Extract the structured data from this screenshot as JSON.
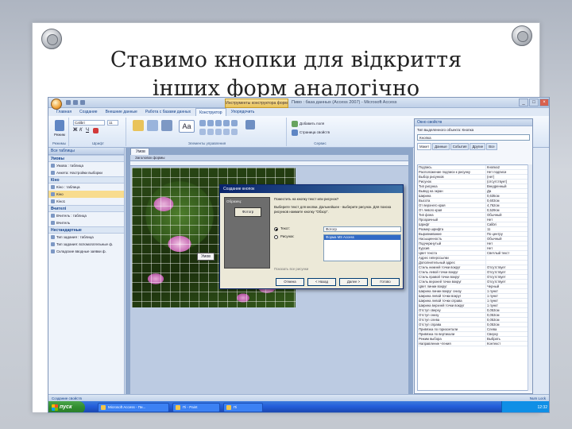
{
  "slide": {
    "title_line1": "Ставимо кнопки для відкриття",
    "title_line2": "інших форм аналогічно"
  },
  "app": {
    "context_tab": "Инструменты конструктора форм",
    "title": "Пиво : база данных (Access 2007) - Microsoft Access",
    "tabs": [
      "Главная",
      "Создание",
      "Внешние данные",
      "Работа с базами данных",
      "Конструктор",
      "Упорядочить"
    ],
    "active_tab_index": 4
  },
  "ribbon": {
    "groups": [
      {
        "label": "Режимы",
        "items": [
          "Режим"
        ]
      },
      {
        "label": "Шрифт",
        "items": [
          "Calibri",
          "11"
        ]
      },
      {
        "label": "Элементы управления",
        "items": []
      },
      {
        "label": "Сервис",
        "items": [
          "Добавить поля",
          "Страница свойств"
        ]
      }
    ]
  },
  "nav": {
    "header": "Все таблицы",
    "groups": [
      {
        "name": "Умовы",
        "items": [
          "Умова : таблица",
          "Анкета: Настройки выборки"
        ]
      },
      {
        "name": "Кіно",
        "items": [
          "Кіно : таблица",
          "Кіно",
          "Кіно1"
        ]
      },
      {
        "name": "Вчителі",
        "items": [
          "Вчитель : таблица",
          "Вчитель"
        ]
      },
      {
        "name": "Нестандартные",
        "items": [
          "Тип задания : таблица",
          "Тип задания: вспомогательные ф.",
          "Складские вводные заявки ф."
        ]
      }
    ]
  },
  "document": {
    "tab": "Умов",
    "header": "Заголовок формы",
    "unit_label": "Умов"
  },
  "wizard": {
    "title": "Создание кнопок",
    "preview_label": "Образец:",
    "preview_button": "Фотогр",
    "question": "Поместить на кнопку текст или рисунок?",
    "instruction": "Выберите текст для кнопки. Дальнейшее - выберите рисунок. Для поиска рисунков нажмите кнопку \"Обзор\".",
    "option_text": "Текст:",
    "option_text_value": "Фотогр",
    "option_picture": "Рисунок:",
    "picture_selected": "Форма MS Access",
    "show_all": "Показать все рисунки",
    "buttons": [
      "Отмена",
      "< Назад",
      "Далее >",
      "Готово"
    ]
  },
  "props": {
    "title": "Окно свойств",
    "subtitle": "Тип выделенного объекта: Кнопка",
    "selected_object": "Кнопка",
    "tabs": [
      "Макет",
      "Данные",
      "События",
      "Другие",
      "Все"
    ],
    "active_tab_index": 0,
    "rows": [
      [
        "Подпись",
        "Кнопка2"
      ],
      [
        "Расположение подписи к рисунку",
        "Нет подписи"
      ],
      [
        "Выбор рисунков",
        "(нет)"
      ],
      [
        "Рисунок",
        "(отсутствует)"
      ],
      [
        "Тип рисунка",
        "Внедренный"
      ],
      [
        "Вывод на экран",
        "Да"
      ],
      [
        "Ширина",
        "0,635см"
      ],
      [
        "Высота",
        "0,603см"
      ],
      [
        "От верхнего края",
        "4,762см"
      ],
      [
        "От левого края",
        "0,529см"
      ],
      [
        "Тип фона",
        "Обычный"
      ],
      [
        "Прозрачный",
        "Нет"
      ],
      [
        "Шрифт",
        "Calibri"
      ],
      [
        "Размер шрифта",
        "11"
      ],
      [
        "Выравнивание",
        "По центру"
      ],
      [
        "Насыщенность",
        "Обычный"
      ],
      [
        "Подчеркнутый",
        "Нет"
      ],
      [
        "Курсив",
        "Нет"
      ],
      [
        "Цвет текста",
        "Светлый текст"
      ],
      [
        "Адрес гиперссылки",
        ""
      ],
      [
        "Дополнительный адрес",
        ""
      ],
      [
        "Стиль нижней точки вокруг",
        "Отсутствует"
      ],
      [
        "Стиль левой точки вокруг",
        "Отсутствует"
      ],
      [
        "Стиль правой точки вокруг",
        "Отсутствует"
      ],
      [
        "Стиль верхней точки вокруг",
        "Отсутствует"
      ],
      [
        "Цвет линии вокруг",
        "Черный"
      ],
      [
        "Ширина линии вокруг снизу",
        "1 пункт"
      ],
      [
        "Ширина левой точки вокруг",
        "1 пункт"
      ],
      [
        "Ширина левой точки справа",
        "1 пункт"
      ],
      [
        "Ширина верхней точки вокруг",
        "1 пункт"
      ],
      [
        "Отступ сверху",
        "0,053см"
      ],
      [
        "Отступ снизу",
        "0,053см"
      ],
      [
        "Отступ слева",
        "0,053см"
      ],
      [
        "Отступ справа",
        "0,053см"
      ],
      [
        "Привязка по горизонтали",
        "Слева"
      ],
      [
        "Привязка по вертикали",
        "Сверху"
      ],
      [
        "Режим выбора",
        "Выбрать"
      ],
      [
        "Направление чтения",
        "Контекст"
      ]
    ]
  },
  "status": {
    "left": "Создание свойств",
    "right": "Num Lock"
  },
  "taskbar": {
    "start": "пуск",
    "buttons": [
      "Microsoft Access - Пи...",
      "Пі - Paint",
      "Пі"
    ],
    "clock": "12:32"
  }
}
